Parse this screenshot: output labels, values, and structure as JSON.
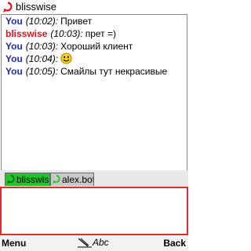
{
  "title": "blisswise",
  "icons": {
    "title": "contact-ring-icon",
    "smiley": "smiley-icon",
    "input_mode": "pen-icon"
  },
  "messages": [
    {
      "sender": "You",
      "sender_color": "#1d2bbf",
      "time": "(10:02):",
      "text": "Привет"
    },
    {
      "sender": "blisswise",
      "sender_color": "#e8101a",
      "time": "(10:03):",
      "text": "прет =)"
    },
    {
      "sender": "You",
      "sender_color": "#1d2bbf",
      "time": "(10:03):",
      "text": "Хороший клиент"
    },
    {
      "sender": "You",
      "sender_color": "#1d2bbf",
      "time": "(10:04):",
      "text": "",
      "smiley": true
    },
    {
      "sender": "You",
      "sender_color": "#1d2bbf",
      "time": "(10:05):",
      "text": "Смайлы тут некрасивые"
    }
  ],
  "tabs": [
    {
      "label": "blisswise",
      "active": true,
      "color": "#21c52b"
    },
    {
      "label": "alex.bot",
      "active": false,
      "color": "#c9c9c9"
    }
  ],
  "input": {
    "value": ""
  },
  "softkeys": {
    "left": "Menu",
    "right": "Back",
    "input_mode": "Abc"
  }
}
